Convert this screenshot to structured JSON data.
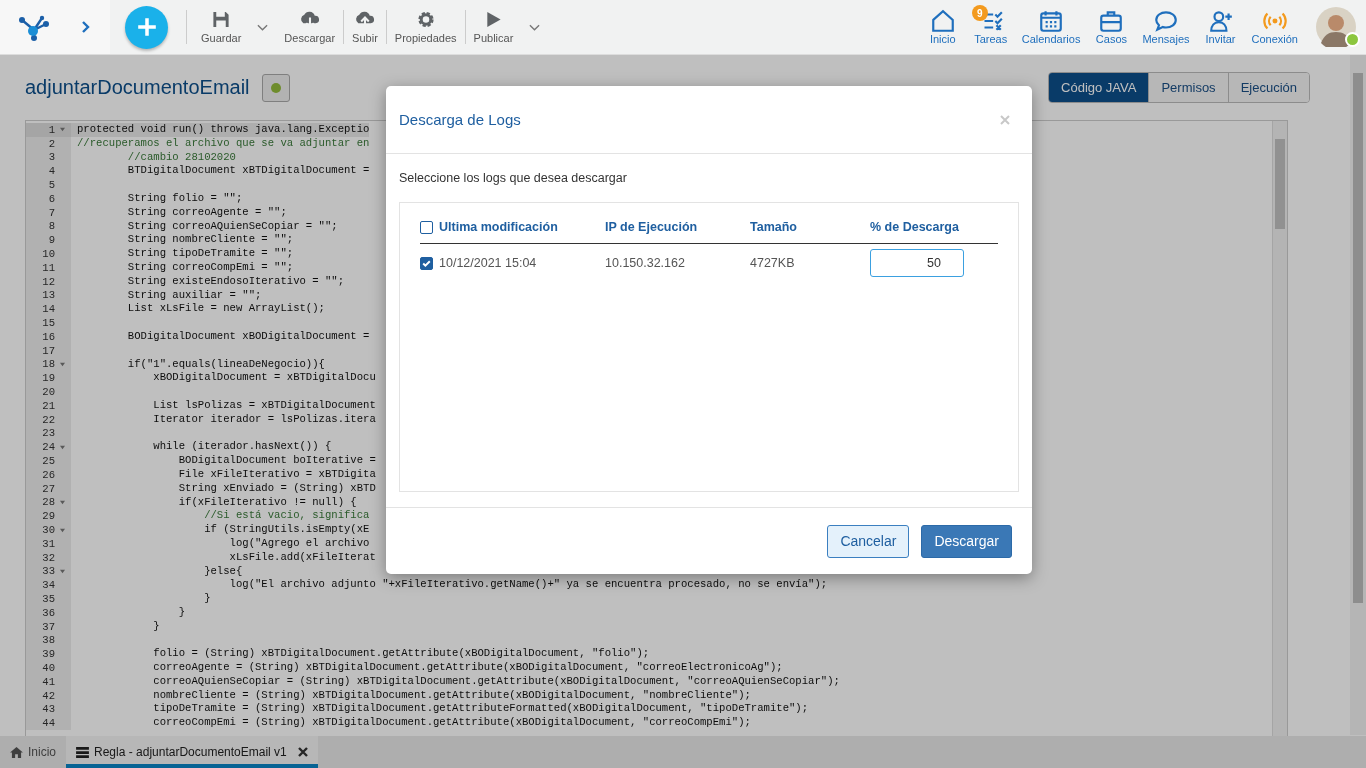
{
  "toolbar": [
    {
      "kind": "save",
      "label": "Guardar"
    },
    {
      "kind": "menu"
    },
    {
      "kind": "download",
      "label": "Descargar"
    },
    {
      "kind": "upload",
      "label": "Subir"
    },
    {
      "kind": "settings",
      "label": "Propiedades"
    },
    {
      "kind": "publish",
      "label": "Publicar"
    },
    {
      "kind": "menu"
    }
  ],
  "nav": [
    {
      "kind": "home",
      "label": "Inicio"
    },
    {
      "kind": "tasks",
      "label": "Tareas",
      "badge": "9"
    },
    {
      "kind": "calendar",
      "label": "Calendarios"
    },
    {
      "kind": "cases",
      "label": "Casos"
    },
    {
      "kind": "messages",
      "label": "Mensajes"
    },
    {
      "kind": "invite",
      "label": "Invitar"
    },
    {
      "kind": "connection",
      "label": "Conexión"
    }
  ],
  "user": {
    "online": true
  },
  "page": {
    "title": "adjuntarDocumentoEmail",
    "status": {
      "color": "#6e8c2c"
    }
  },
  "tabs": [
    {
      "label": "Código JAVA",
      "selected": true
    },
    {
      "label": "Permisos",
      "selected": false
    },
    {
      "label": "Ejecución",
      "selected": false
    }
  ],
  "code": [
    {
      "n": "1",
      "fold": true,
      "kind": "code",
      "text": "protected void run() throws java.lang.Exceptio"
    },
    {
      "n": "2",
      "fold": false,
      "kind": "comment",
      "text": "//recuperamos el archivo que se va adjuntar en"
    },
    {
      "n": "3",
      "fold": false,
      "kind": "comment",
      "text": "        //cambio 28102020"
    },
    {
      "n": "4",
      "fold": false,
      "kind": "code",
      "text": "        BTDigitalDocument xBTDigitalDocument ="
    },
    {
      "n": "5",
      "fold": false,
      "kind": "code"
    },
    {
      "n": "6",
      "fold": false,
      "kind": "code",
      "text": "        String folio = \"\";"
    },
    {
      "n": "7",
      "fold": false,
      "kind": "code",
      "text": "        String correoAgente = \"\";"
    },
    {
      "n": "8",
      "fold": false,
      "kind": "code",
      "text": "        String correoAQuienSeCopiar = \"\";"
    },
    {
      "n": "9",
      "fold": false,
      "kind": "code",
      "text": "        String nombreCliente = \"\";"
    },
    {
      "n": "10",
      "fold": false,
      "kind": "code",
      "text": "        String tipoDeTramite = \"\";"
    },
    {
      "n": "11",
      "fold": false,
      "kind": "code",
      "text": "        String correoCompEmi = \"\";"
    },
    {
      "n": "12",
      "fold": false,
      "kind": "code",
      "text": "        String existeEndosoIterativo = \"\";"
    },
    {
      "n": "13",
      "fold": false,
      "kind": "code",
      "text": "        String auxiliar = \"\";"
    },
    {
      "n": "14",
      "fold": false,
      "kind": "code",
      "text": "        List xLsFile = new ArrayList();"
    },
    {
      "n": "15",
      "fold": false,
      "kind": "code"
    },
    {
      "n": "16",
      "fold": false,
      "kind": "code",
      "text": "        BODigitalDocument xBODigitalDocument ="
    },
    {
      "n": "17",
      "fold": false,
      "kind": "code"
    },
    {
      "n": "18",
      "fold": true,
      "kind": "code",
      "text": "        if(\"1\".equals(lineaDeNegocio)){"
    },
    {
      "n": "19",
      "fold": false,
      "kind": "code",
      "text": "            xBODigitalDocument = xBTDigitalDocu"
    },
    {
      "n": "20",
      "fold": false,
      "kind": "code"
    },
    {
      "n": "21",
      "fold": false,
      "kind": "code",
      "text": "            List lsPolizas = xBTDigitalDocument"
    },
    {
      "n": "22",
      "fold": false,
      "kind": "code",
      "text": "            Iterator iterador = lsPolizas.itera"
    },
    {
      "n": "23",
      "fold": false,
      "kind": "code"
    },
    {
      "n": "24",
      "fold": true,
      "kind": "code",
      "text": "            while (iterador.hasNext()) {"
    },
    {
      "n": "25",
      "fold": false,
      "kind": "code",
      "text": "                BODigitalDocument boIterative ="
    },
    {
      "n": "26",
      "fold": false,
      "kind": "code",
      "text": "                File xFileIterativo = xBTDigita"
    },
    {
      "n": "27",
      "fold": false,
      "kind": "code",
      "text": "                String xEnviado = (String) xBTD"
    },
    {
      "n": "28",
      "fold": true,
      "kind": "code",
      "text": "                if(xFileIterativo != null) {"
    },
    {
      "n": "29",
      "fold": false,
      "kind": "comment",
      "text": "                    //Si está vacio, significa"
    },
    {
      "n": "30",
      "fold": true,
      "kind": "code",
      "text": "                    if (StringUtils.isEmpty(xE"
    },
    {
      "n": "31",
      "fold": false,
      "kind": "code",
      "text": "                        log(\"Agrego el archivo"
    },
    {
      "n": "32",
      "fold": false,
      "kind": "code",
      "text": "                        xLsFile.add(xFileIterat"
    },
    {
      "n": "33",
      "fold": true,
      "kind": "code",
      "text": "                    }else{"
    },
    {
      "n": "34",
      "fold": false,
      "kind": "code",
      "text": "                        log(\"El archivo adjunto \"+xFileIterativo.getName()+\" ya se encuentra procesado, no se envía\");"
    },
    {
      "n": "35",
      "fold": false,
      "kind": "code",
      "text": "                    }"
    },
    {
      "n": "36",
      "fold": false,
      "kind": "code",
      "text": "                }"
    },
    {
      "n": "37",
      "fold": false,
      "kind": "code",
      "text": "            }"
    },
    {
      "n": "38",
      "fold": false,
      "kind": "code"
    },
    {
      "n": "39",
      "fold": false,
      "kind": "code",
      "text": "            folio = (String) xBTDigitalDocument.getAttribute(xBODigitalDocument, \"folio\");"
    },
    {
      "n": "40",
      "fold": false,
      "kind": "code",
      "text": "            correoAgente = (String) xBTDigitalDocument.getAttribute(xBODigitalDocument, \"correoElectronicoAg\");"
    },
    {
      "n": "41",
      "fold": false,
      "kind": "code",
      "text": "            correoAQuienSeCopiar = (String) xBTDigitalDocument.getAttribute(xBODigitalDocument, \"correoAQuienSeCopiar\");"
    },
    {
      "n": "42",
      "fold": false,
      "kind": "code",
      "text": "            nombreCliente = (String) xBTDigitalDocument.getAttribute(xBODigitalDocument, \"nombreCliente\");"
    },
    {
      "n": "43",
      "fold": false,
      "kind": "code",
      "text": "            tipoDeTramite = (String) xBTDigitalDocument.getAttributeFormatted(xBODigitalDocument, \"tipoDeTramite\");"
    },
    {
      "n": "44",
      "fold": false,
      "kind": "code",
      "text": "            correoCompEmi = (String) xBTDigitalDocument.getAttribute(xBODigitalDocument, \"correoCompEmi\");"
    }
  ],
  "bottom_tabs": [
    {
      "kind": "home",
      "label": "Inicio",
      "selected": false
    },
    {
      "kind": "rule",
      "label": "Regla - adjuntarDocumentoEmail v1",
      "selected": true,
      "closable": true
    }
  ],
  "dialog": {
    "title": "Descarga de Logs",
    "prompt": "Seleccione los logs que desea descargar",
    "table": {
      "select_all_checked": false,
      "columns": [
        "Ultima modificación",
        "IP de Ejecución",
        "Tamaño",
        "% de Descarga"
      ],
      "rows": [
        {
          "checked": true,
          "date": "10/12/2021 15:04",
          "ip": "10.150.32.162",
          "size": "4727KB",
          "percent": "50"
        }
      ]
    },
    "buttons": [
      {
        "kind": "secondary",
        "label": "Cancelar"
      },
      {
        "kind": "primary",
        "label": "Descargar"
      }
    ]
  }
}
